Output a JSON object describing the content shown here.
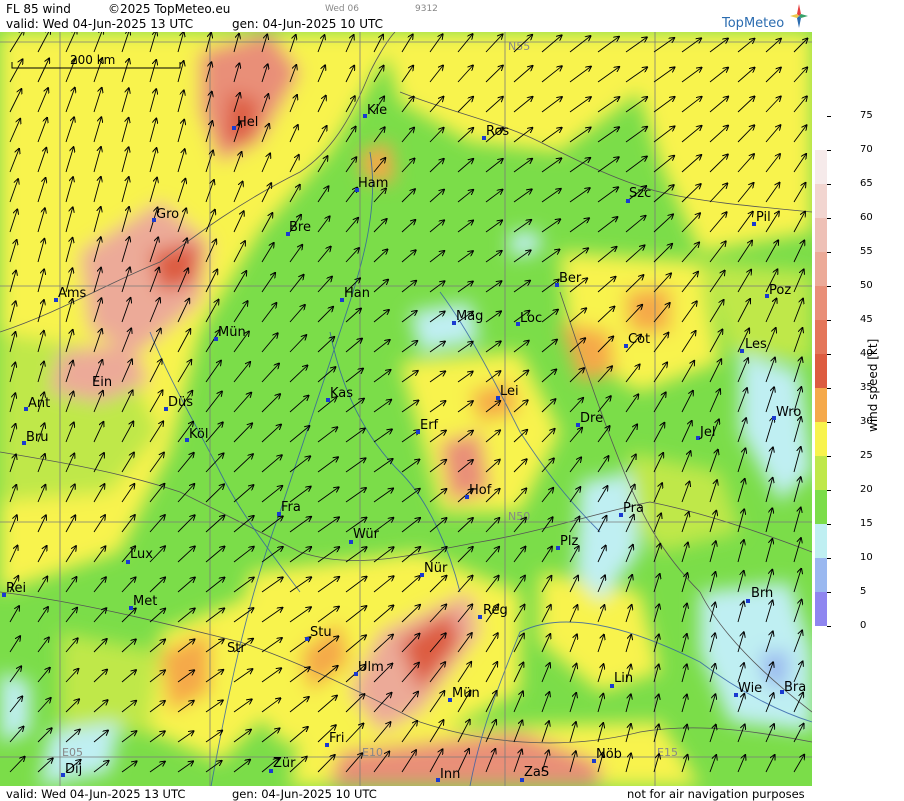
{
  "header": {
    "product": "FL 85 wind",
    "copyright": "©2025 TopMeteo.eu",
    "day_short": "Wed 06",
    "code": "9312",
    "valid": "valid:  Wed  04-Jun-2025  13 UTC",
    "generated": "gen: 04-Jun-2025 10 UTC",
    "logo": "TopMeteo"
  },
  "footer": {
    "valid": "valid:  Wed  04-Jun-2025  13 UTC",
    "generated": "gen: 04-Jun-2025 10 UTC",
    "notice": "not for air navigation purposes"
  },
  "map": {
    "scale_label": "200 km",
    "gridlines": [
      "N55",
      "N50",
      "E05",
      "E10",
      "E15"
    ],
    "cities": [
      "Hel",
      "Kie",
      "Ros",
      "Ham",
      "Gro",
      "Bre",
      "Szc",
      "Pil",
      "Ams",
      "Han",
      "Ber",
      "Poz",
      "Mag",
      "Loc",
      "Mün",
      "Cot",
      "Les",
      "Ein",
      "Kas",
      "Lei",
      "Ant",
      "Düs",
      "Dre",
      "Wro",
      "Bru",
      "Köl",
      "Erf",
      "Jel",
      "Hof",
      "Fra",
      "Pra",
      "Wür",
      "Plz",
      "Lux",
      "Nür",
      "Rei",
      "Met",
      "Brn",
      "Reg",
      "Stu",
      "Str",
      "Ulm",
      "Lin",
      "Wie",
      "Bra",
      "Mün",
      "Fri",
      "Dij",
      "Zür",
      "Nöb",
      "Inn",
      "ZaS"
    ]
  },
  "legend": {
    "title": "wind speed [kt]",
    "ticks": [
      "75",
      "70",
      "65",
      "60",
      "55",
      "50",
      "45",
      "40",
      "35",
      "30",
      "25",
      "20",
      "15",
      "10",
      "5",
      "0"
    ],
    "colors": [
      "#ffffff",
      "#f6eaea",
      "#f2d5d0",
      "#eec0b6",
      "#ecaa98",
      "#e98f78",
      "#e4765a",
      "#dd5c40",
      "#f5a94a",
      "#f8f34d",
      "#bfe84a",
      "#7bdd49",
      "#bfeff2",
      "#9ab8f0",
      "#8f86f0",
      "#b98cf2"
    ]
  }
}
